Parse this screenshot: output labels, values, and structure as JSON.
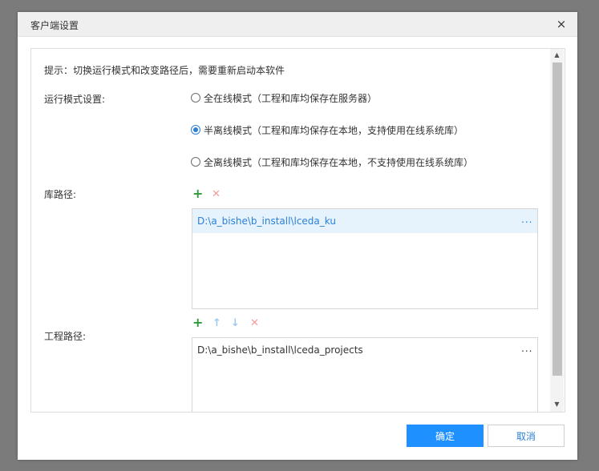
{
  "window": {
    "title": "客户端设置",
    "close_glyph": "×"
  },
  "hint": "提示：切换运行模式和改变路径后，需要重新启动本软件",
  "run_mode": {
    "label": "运行模式设置:",
    "options": [
      {
        "label": "全在线模式（工程和库均保存在服务器）",
        "checked": false
      },
      {
        "label": "半离线模式（工程和库均保存在本地，支持使用在线系统库）",
        "checked": true
      },
      {
        "label": "全离线模式（工程和库均保存在本地，不支持使用在线系统库）",
        "checked": false
      }
    ]
  },
  "library_path": {
    "label": "库路径:",
    "paths": [
      {
        "value": "D:\\a_bishe\\b_install\\lceda_ku",
        "more": "...",
        "selected": true
      }
    ]
  },
  "project_path": {
    "label": "工程路径:",
    "paths": [
      {
        "value": "D:\\a_bishe\\b_install\\lceda_projects",
        "more": "...",
        "selected": false
      }
    ]
  },
  "icons": {
    "add": "+",
    "remove": "✕",
    "move_up": "↑",
    "move_down": "↓"
  },
  "footer": {
    "ok_label": "确定",
    "cancel_label": "取消"
  },
  "colors": {
    "accent": "#1e90ff",
    "add_icon": "#2e9a3a",
    "remove_icon": "#f39a9a",
    "selected_row": "#e6f3fc"
  }
}
